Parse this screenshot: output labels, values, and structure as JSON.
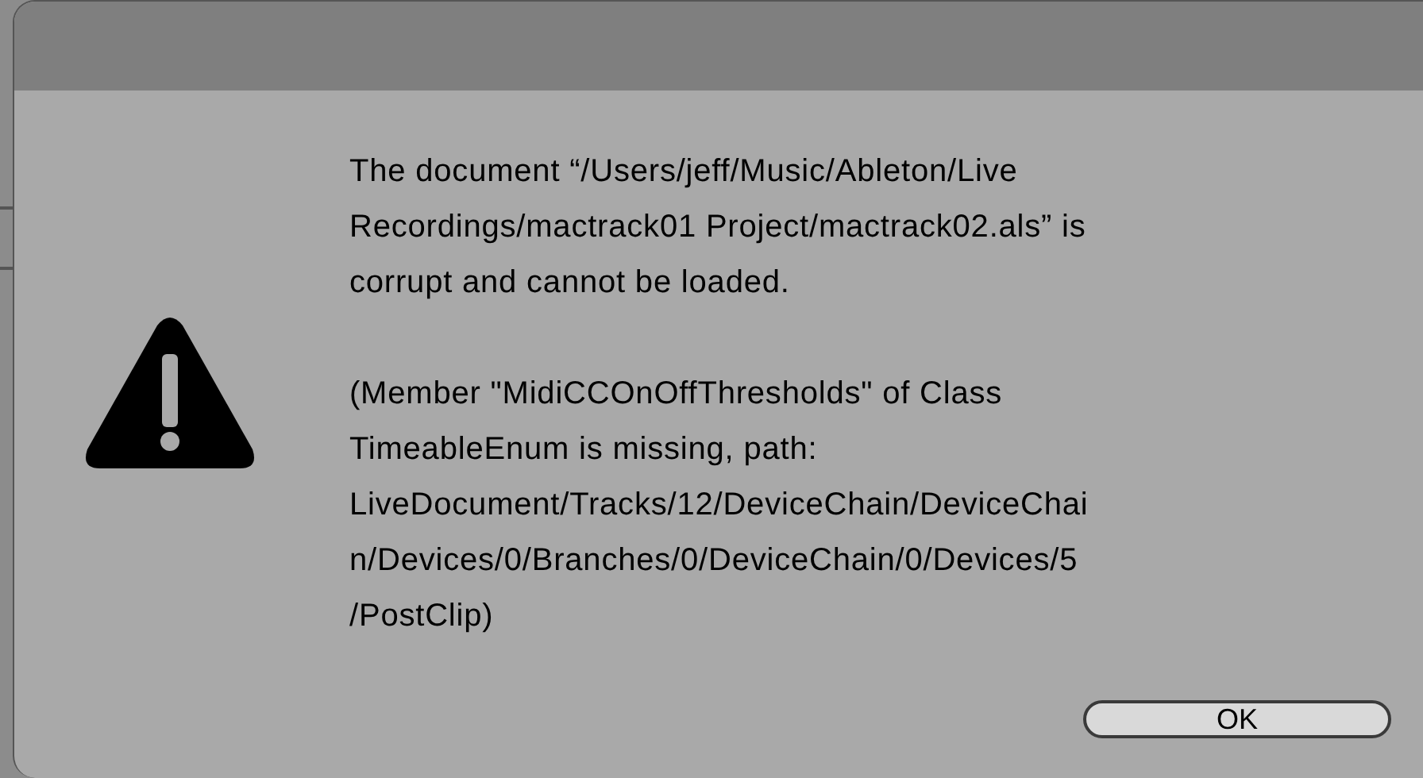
{
  "dialog": {
    "message": [
      {
        "lines": [
          "The document “/Users/jeff/Music/Ableton/Live",
          "Recordings/mactrack01 Project/mactrack02.als” is",
          "corrupt and cannot be loaded."
        ]
      },
      {
        "lines": [
          "(Member \"MidiCCOnOffThresholds\" of Class",
          "TimeableEnum is missing, path:",
          "LiveDocument/Tracks/12/DeviceChain/DeviceChai",
          "n/Devices/0/Branches/0/DeviceChain/0/Devices/5",
          "/PostClip)"
        ]
      }
    ],
    "buttons": [
      "OK"
    ]
  }
}
